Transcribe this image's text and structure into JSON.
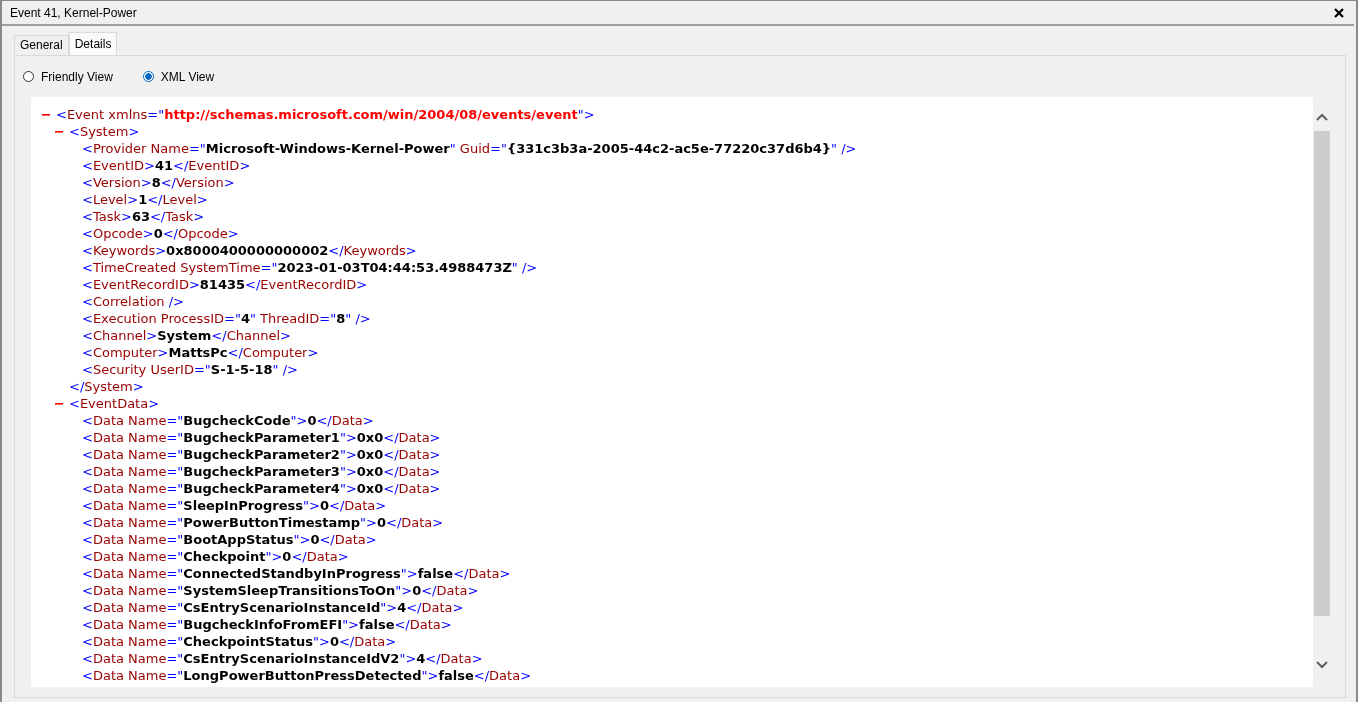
{
  "window": {
    "title": "Event 41, Kernel-Power"
  },
  "tabs": [
    {
      "label": "General",
      "selected": false
    },
    {
      "label": "Details",
      "selected": true
    }
  ],
  "views": [
    {
      "label": "Friendly View",
      "selected": false
    },
    {
      "label": "XML View",
      "selected": true
    }
  ],
  "xml": {
    "expanded": true,
    "open": [
      {
        "kind": "punct",
        "text": "<"
      },
      {
        "kind": "tag",
        "text": "Event"
      },
      {
        "kind": "attribute",
        "text": " xmlns"
      },
      {
        "kind": "punct",
        "text": "=\""
      },
      {
        "kind": "namespace",
        "text": "http://schemas.microsoft.com/win/2004/08/events/event"
      },
      {
        "kind": "punct",
        "text": "\">"
      }
    ],
    "children": [
      {
        "expanded": true,
        "open": [
          {
            "kind": "punct",
            "text": "<"
          },
          {
            "kind": "tag",
            "text": "System"
          },
          {
            "kind": "punct",
            "text": ">"
          }
        ],
        "close": [
          {
            "kind": "punct",
            "text": "</"
          },
          {
            "kind": "tag",
            "text": "System"
          },
          {
            "kind": "punct",
            "text": ">"
          }
        ],
        "children": [
          {
            "open": [
              {
                "kind": "punct",
                "text": "<"
              },
              {
                "kind": "tag",
                "text": "Provider"
              },
              {
                "kind": "attribute",
                "text": " Name"
              },
              {
                "kind": "punct",
                "text": "=\""
              },
              {
                "kind": "value",
                "text": "Microsoft-Windows-Kernel-Power"
              },
              {
                "kind": "punct",
                "text": "\""
              },
              {
                "kind": "attribute",
                "text": " Guid"
              },
              {
                "kind": "punct",
                "text": "=\""
              },
              {
                "kind": "value",
                "text": "{331c3b3a-2005-44c2-ac5e-77220c37d6b4}"
              },
              {
                "kind": "punct",
                "text": "\" />"
              }
            ]
          },
          {
            "open": [
              {
                "kind": "punct",
                "text": "<"
              },
              {
                "kind": "tag",
                "text": "EventID"
              },
              {
                "kind": "punct",
                "text": ">"
              },
              {
                "kind": "value",
                "text": "41"
              },
              {
                "kind": "punct",
                "text": "</"
              },
              {
                "kind": "tag",
                "text": "EventID"
              },
              {
                "kind": "punct",
                "text": ">"
              }
            ]
          },
          {
            "open": [
              {
                "kind": "punct",
                "text": "<"
              },
              {
                "kind": "tag",
                "text": "Version"
              },
              {
                "kind": "punct",
                "text": ">"
              },
              {
                "kind": "value",
                "text": "8"
              },
              {
                "kind": "punct",
                "text": "</"
              },
              {
                "kind": "tag",
                "text": "Version"
              },
              {
                "kind": "punct",
                "text": ">"
              }
            ]
          },
          {
            "open": [
              {
                "kind": "punct",
                "text": "<"
              },
              {
                "kind": "tag",
                "text": "Level"
              },
              {
                "kind": "punct",
                "text": ">"
              },
              {
                "kind": "value",
                "text": "1"
              },
              {
                "kind": "punct",
                "text": "</"
              },
              {
                "kind": "tag",
                "text": "Level"
              },
              {
                "kind": "punct",
                "text": ">"
              }
            ]
          },
          {
            "open": [
              {
                "kind": "punct",
                "text": "<"
              },
              {
                "kind": "tag",
                "text": "Task"
              },
              {
                "kind": "punct",
                "text": ">"
              },
              {
                "kind": "value",
                "text": "63"
              },
              {
                "kind": "punct",
                "text": "</"
              },
              {
                "kind": "tag",
                "text": "Task"
              },
              {
                "kind": "punct",
                "text": ">"
              }
            ]
          },
          {
            "open": [
              {
                "kind": "punct",
                "text": "<"
              },
              {
                "kind": "tag",
                "text": "Opcode"
              },
              {
                "kind": "punct",
                "text": ">"
              },
              {
                "kind": "value",
                "text": "0"
              },
              {
                "kind": "punct",
                "text": "</"
              },
              {
                "kind": "tag",
                "text": "Opcode"
              },
              {
                "kind": "punct",
                "text": ">"
              }
            ]
          },
          {
            "open": [
              {
                "kind": "punct",
                "text": "<"
              },
              {
                "kind": "tag",
                "text": "Keywords"
              },
              {
                "kind": "punct",
                "text": ">"
              },
              {
                "kind": "value",
                "text": "0x8000400000000002"
              },
              {
                "kind": "punct",
                "text": "</"
              },
              {
                "kind": "tag",
                "text": "Keywords"
              },
              {
                "kind": "punct",
                "text": ">"
              }
            ]
          },
          {
            "open": [
              {
                "kind": "punct",
                "text": "<"
              },
              {
                "kind": "tag",
                "text": "TimeCreated"
              },
              {
                "kind": "attribute",
                "text": " SystemTime"
              },
              {
                "kind": "punct",
                "text": "=\""
              },
              {
                "kind": "value",
                "text": "2023-01-03T04:44:53.4988473Z"
              },
              {
                "kind": "punct",
                "text": "\" />"
              }
            ]
          },
          {
            "open": [
              {
                "kind": "punct",
                "text": "<"
              },
              {
                "kind": "tag",
                "text": "EventRecordID"
              },
              {
                "kind": "punct",
                "text": ">"
              },
              {
                "kind": "value",
                "text": "81435"
              },
              {
                "kind": "punct",
                "text": "</"
              },
              {
                "kind": "tag",
                "text": "EventRecordID"
              },
              {
                "kind": "punct",
                "text": ">"
              }
            ]
          },
          {
            "open": [
              {
                "kind": "punct",
                "text": "<"
              },
              {
                "kind": "tag",
                "text": "Correlation"
              },
              {
                "kind": "punct",
                "text": " />"
              }
            ]
          },
          {
            "open": [
              {
                "kind": "punct",
                "text": "<"
              },
              {
                "kind": "tag",
                "text": "Execution"
              },
              {
                "kind": "attribute",
                "text": " ProcessID"
              },
              {
                "kind": "punct",
                "text": "=\""
              },
              {
                "kind": "value",
                "text": "4"
              },
              {
                "kind": "punct",
                "text": "\""
              },
              {
                "kind": "attribute",
                "text": " ThreadID"
              },
              {
                "kind": "punct",
                "text": "=\""
              },
              {
                "kind": "value",
                "text": "8"
              },
              {
                "kind": "punct",
                "text": "\" />"
              }
            ]
          },
          {
            "open": [
              {
                "kind": "punct",
                "text": "<"
              },
              {
                "kind": "tag",
                "text": "Channel"
              },
              {
                "kind": "punct",
                "text": ">"
              },
              {
                "kind": "value",
                "text": "System"
              },
              {
                "kind": "punct",
                "text": "</"
              },
              {
                "kind": "tag",
                "text": "Channel"
              },
              {
                "kind": "punct",
                "text": ">"
              }
            ]
          },
          {
            "open": [
              {
                "kind": "punct",
                "text": "<"
              },
              {
                "kind": "tag",
                "text": "Computer"
              },
              {
                "kind": "punct",
                "text": ">"
              },
              {
                "kind": "value",
                "text": "MattsPc"
              },
              {
                "kind": "punct",
                "text": "</"
              },
              {
                "kind": "tag",
                "text": "Computer"
              },
              {
                "kind": "punct",
                "text": ">"
              }
            ]
          },
          {
            "open": [
              {
                "kind": "punct",
                "text": "<"
              },
              {
                "kind": "tag",
                "text": "Security"
              },
              {
                "kind": "attribute",
                "text": " UserID"
              },
              {
                "kind": "punct",
                "text": "=\""
              },
              {
                "kind": "value",
                "text": "S-1-5-18"
              },
              {
                "kind": "punct",
                "text": "\" />"
              }
            ]
          }
        ]
      },
      {
        "expanded": true,
        "open": [
          {
            "kind": "punct",
            "text": "<"
          },
          {
            "kind": "tag",
            "text": "EventData"
          },
          {
            "kind": "punct",
            "text": ">"
          }
        ],
        "children": [
          {
            "open": [
              {
                "kind": "punct",
                "text": "<"
              },
              {
                "kind": "tag",
                "text": "Data"
              },
              {
                "kind": "attribute",
                "text": " Name"
              },
              {
                "kind": "punct",
                "text": "=\""
              },
              {
                "kind": "value",
                "text": "BugcheckCode"
              },
              {
                "kind": "punct",
                "text": "\">"
              },
              {
                "kind": "value",
                "text": "0"
              },
              {
                "kind": "punct",
                "text": "</"
              },
              {
                "kind": "tag",
                "text": "Data"
              },
              {
                "kind": "punct",
                "text": ">"
              }
            ]
          },
          {
            "open": [
              {
                "kind": "punct",
                "text": "<"
              },
              {
                "kind": "tag",
                "text": "Data"
              },
              {
                "kind": "attribute",
                "text": " Name"
              },
              {
                "kind": "punct",
                "text": "=\""
              },
              {
                "kind": "value",
                "text": "BugcheckParameter1"
              },
              {
                "kind": "punct",
                "text": "\">"
              },
              {
                "kind": "value",
                "text": "0x0"
              },
              {
                "kind": "punct",
                "text": "</"
              },
              {
                "kind": "tag",
                "text": "Data"
              },
              {
                "kind": "punct",
                "text": ">"
              }
            ]
          },
          {
            "open": [
              {
                "kind": "punct",
                "text": "<"
              },
              {
                "kind": "tag",
                "text": "Data"
              },
              {
                "kind": "attribute",
                "text": " Name"
              },
              {
                "kind": "punct",
                "text": "=\""
              },
              {
                "kind": "value",
                "text": "BugcheckParameter2"
              },
              {
                "kind": "punct",
                "text": "\">"
              },
              {
                "kind": "value",
                "text": "0x0"
              },
              {
                "kind": "punct",
                "text": "</"
              },
              {
                "kind": "tag",
                "text": "Data"
              },
              {
                "kind": "punct",
                "text": ">"
              }
            ]
          },
          {
            "open": [
              {
                "kind": "punct",
                "text": "<"
              },
              {
                "kind": "tag",
                "text": "Data"
              },
              {
                "kind": "attribute",
                "text": " Name"
              },
              {
                "kind": "punct",
                "text": "=\""
              },
              {
                "kind": "value",
                "text": "BugcheckParameter3"
              },
              {
                "kind": "punct",
                "text": "\">"
              },
              {
                "kind": "value",
                "text": "0x0"
              },
              {
                "kind": "punct",
                "text": "</"
              },
              {
                "kind": "tag",
                "text": "Data"
              },
              {
                "kind": "punct",
                "text": ">"
              }
            ]
          },
          {
            "open": [
              {
                "kind": "punct",
                "text": "<"
              },
              {
                "kind": "tag",
                "text": "Data"
              },
              {
                "kind": "attribute",
                "text": " Name"
              },
              {
                "kind": "punct",
                "text": "=\""
              },
              {
                "kind": "value",
                "text": "BugcheckParameter4"
              },
              {
                "kind": "punct",
                "text": "\">"
              },
              {
                "kind": "value",
                "text": "0x0"
              },
              {
                "kind": "punct",
                "text": "</"
              },
              {
                "kind": "tag",
                "text": "Data"
              },
              {
                "kind": "punct",
                "text": ">"
              }
            ]
          },
          {
            "open": [
              {
                "kind": "punct",
                "text": "<"
              },
              {
                "kind": "tag",
                "text": "Data"
              },
              {
                "kind": "attribute",
                "text": " Name"
              },
              {
                "kind": "punct",
                "text": "=\""
              },
              {
                "kind": "value",
                "text": "SleepInProgress"
              },
              {
                "kind": "punct",
                "text": "\">"
              },
              {
                "kind": "value",
                "text": "0"
              },
              {
                "kind": "punct",
                "text": "</"
              },
              {
                "kind": "tag",
                "text": "Data"
              },
              {
                "kind": "punct",
                "text": ">"
              }
            ]
          },
          {
            "open": [
              {
                "kind": "punct",
                "text": "<"
              },
              {
                "kind": "tag",
                "text": "Data"
              },
              {
                "kind": "attribute",
                "text": " Name"
              },
              {
                "kind": "punct",
                "text": "=\""
              },
              {
                "kind": "value",
                "text": "PowerButtonTimestamp"
              },
              {
                "kind": "punct",
                "text": "\">"
              },
              {
                "kind": "value",
                "text": "0"
              },
              {
                "kind": "punct",
                "text": "</"
              },
              {
                "kind": "tag",
                "text": "Data"
              },
              {
                "kind": "punct",
                "text": ">"
              }
            ]
          },
          {
            "open": [
              {
                "kind": "punct",
                "text": "<"
              },
              {
                "kind": "tag",
                "text": "Data"
              },
              {
                "kind": "attribute",
                "text": " Name"
              },
              {
                "kind": "punct",
                "text": "=\""
              },
              {
                "kind": "value",
                "text": "BootAppStatus"
              },
              {
                "kind": "punct",
                "text": "\">"
              },
              {
                "kind": "value",
                "text": "0"
              },
              {
                "kind": "punct",
                "text": "</"
              },
              {
                "kind": "tag",
                "text": "Data"
              },
              {
                "kind": "punct",
                "text": ">"
              }
            ]
          },
          {
            "open": [
              {
                "kind": "punct",
                "text": "<"
              },
              {
                "kind": "tag",
                "text": "Data"
              },
              {
                "kind": "attribute",
                "text": " Name"
              },
              {
                "kind": "punct",
                "text": "=\""
              },
              {
                "kind": "value",
                "text": "Checkpoint"
              },
              {
                "kind": "punct",
                "text": "\">"
              },
              {
                "kind": "value",
                "text": "0"
              },
              {
                "kind": "punct",
                "text": "</"
              },
              {
                "kind": "tag",
                "text": "Data"
              },
              {
                "kind": "punct",
                "text": ">"
              }
            ]
          },
          {
            "open": [
              {
                "kind": "punct",
                "text": "<"
              },
              {
                "kind": "tag",
                "text": "Data"
              },
              {
                "kind": "attribute",
                "text": " Name"
              },
              {
                "kind": "punct",
                "text": "=\""
              },
              {
                "kind": "value",
                "text": "ConnectedStandbyInProgress"
              },
              {
                "kind": "punct",
                "text": "\">"
              },
              {
                "kind": "value",
                "text": "false"
              },
              {
                "kind": "punct",
                "text": "</"
              },
              {
                "kind": "tag",
                "text": "Data"
              },
              {
                "kind": "punct",
                "text": ">"
              }
            ]
          },
          {
            "open": [
              {
                "kind": "punct",
                "text": "<"
              },
              {
                "kind": "tag",
                "text": "Data"
              },
              {
                "kind": "attribute",
                "text": " Name"
              },
              {
                "kind": "punct",
                "text": "=\""
              },
              {
                "kind": "value",
                "text": "SystemSleepTransitionsToOn"
              },
              {
                "kind": "punct",
                "text": "\">"
              },
              {
                "kind": "value",
                "text": "0"
              },
              {
                "kind": "punct",
                "text": "</"
              },
              {
                "kind": "tag",
                "text": "Data"
              },
              {
                "kind": "punct",
                "text": ">"
              }
            ]
          },
          {
            "open": [
              {
                "kind": "punct",
                "text": "<"
              },
              {
                "kind": "tag",
                "text": "Data"
              },
              {
                "kind": "attribute",
                "text": " Name"
              },
              {
                "kind": "punct",
                "text": "=\""
              },
              {
                "kind": "value",
                "text": "CsEntryScenarioInstanceId"
              },
              {
                "kind": "punct",
                "text": "\">"
              },
              {
                "kind": "value",
                "text": "4"
              },
              {
                "kind": "punct",
                "text": "</"
              },
              {
                "kind": "tag",
                "text": "Data"
              },
              {
                "kind": "punct",
                "text": ">"
              }
            ]
          },
          {
            "open": [
              {
                "kind": "punct",
                "text": "<"
              },
              {
                "kind": "tag",
                "text": "Data"
              },
              {
                "kind": "attribute",
                "text": " Name"
              },
              {
                "kind": "punct",
                "text": "=\""
              },
              {
                "kind": "value",
                "text": "BugcheckInfoFromEFI"
              },
              {
                "kind": "punct",
                "text": "\">"
              },
              {
                "kind": "value",
                "text": "false"
              },
              {
                "kind": "punct",
                "text": "</"
              },
              {
                "kind": "tag",
                "text": "Data"
              },
              {
                "kind": "punct",
                "text": ">"
              }
            ]
          },
          {
            "open": [
              {
                "kind": "punct",
                "text": "<"
              },
              {
                "kind": "tag",
                "text": "Data"
              },
              {
                "kind": "attribute",
                "text": " Name"
              },
              {
                "kind": "punct",
                "text": "=\""
              },
              {
                "kind": "value",
                "text": "CheckpointStatus"
              },
              {
                "kind": "punct",
                "text": "\">"
              },
              {
                "kind": "value",
                "text": "0"
              },
              {
                "kind": "punct",
                "text": "</"
              },
              {
                "kind": "tag",
                "text": "Data"
              },
              {
                "kind": "punct",
                "text": ">"
              }
            ]
          },
          {
            "open": [
              {
                "kind": "punct",
                "text": "<"
              },
              {
                "kind": "tag",
                "text": "Data"
              },
              {
                "kind": "attribute",
                "text": " Name"
              },
              {
                "kind": "punct",
                "text": "=\""
              },
              {
                "kind": "value",
                "text": "CsEntryScenarioInstanceIdV2"
              },
              {
                "kind": "punct",
                "text": "\">"
              },
              {
                "kind": "value",
                "text": "4"
              },
              {
                "kind": "punct",
                "text": "</"
              },
              {
                "kind": "tag",
                "text": "Data"
              },
              {
                "kind": "punct",
                "text": ">"
              }
            ]
          },
          {
            "open": [
              {
                "kind": "punct",
                "text": "<"
              },
              {
                "kind": "tag",
                "text": "Data"
              },
              {
                "kind": "attribute",
                "text": " Name"
              },
              {
                "kind": "punct",
                "text": "=\""
              },
              {
                "kind": "value",
                "text": "LongPowerButtonPressDetected"
              },
              {
                "kind": "punct",
                "text": "\">"
              },
              {
                "kind": "value",
                "text": "false"
              },
              {
                "kind": "punct",
                "text": "</"
              },
              {
                "kind": "tag",
                "text": "Data"
              },
              {
                "kind": "punct",
                "text": ">"
              }
            ]
          }
        ]
      }
    ]
  }
}
